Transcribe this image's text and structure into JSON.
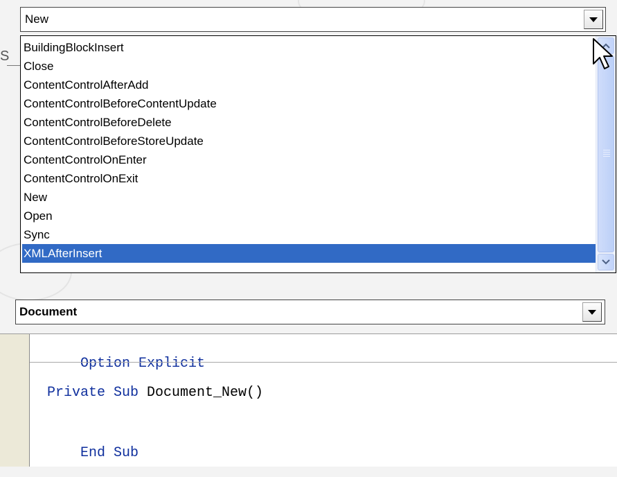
{
  "procedure_combo": {
    "value": "New",
    "options": [
      "BuildingBlockInsert",
      "Close",
      "ContentControlAfterAdd",
      "ContentControlBeforeContentUpdate",
      "ContentControlBeforeDelete",
      "ContentControlBeforeStoreUpdate",
      "ContentControlOnEnter",
      "ContentControlOnExit",
      "New",
      "Open",
      "Sync",
      "XMLAfterInsert"
    ],
    "highlighted": "XMLAfterInsert"
  },
  "background_letter": "S",
  "object_combo": {
    "value": "Document"
  },
  "code": {
    "line1": {
      "keyword": "Option Explicit"
    },
    "line2": {
      "keyword": "Private Sub",
      "rest": " Document_New()"
    },
    "line3": {
      "keyword": "End Sub"
    }
  },
  "colors": {
    "selection": "#316ac5",
    "keyword": "#0f2f9d",
    "scrollbar": "#c1d3fa"
  },
  "icons": [
    "dropdown-arrow-icon",
    "scroll-up-icon",
    "scroll-down-icon",
    "mouse-cursor-icon"
  ]
}
